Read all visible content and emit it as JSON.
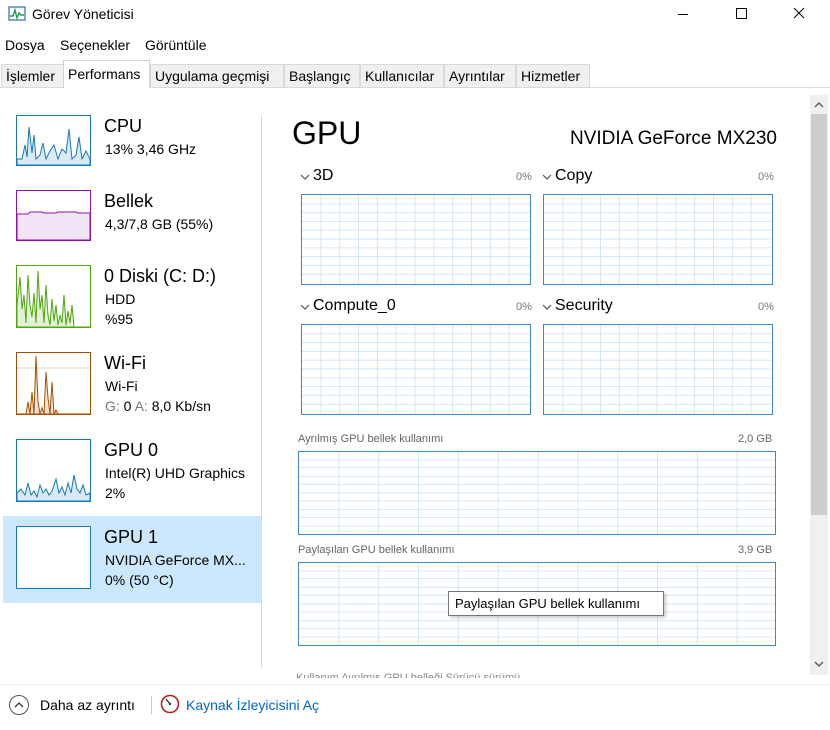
{
  "window": {
    "title": "Görev Yöneticisi",
    "icon": "task-manager-icon"
  },
  "menu": [
    "Dosya",
    "Seçenekler",
    "Görüntüle"
  ],
  "tabs": [
    {
      "label": "İşlemler",
      "active": false
    },
    {
      "label": "Performans",
      "active": true
    },
    {
      "label": "Uygulama geçmişi",
      "active": false
    },
    {
      "label": "Başlangıç",
      "active": false
    },
    {
      "label": "Kullanıcılar",
      "active": false
    },
    {
      "label": "Ayrıntılar",
      "active": false
    },
    {
      "label": "Hizmetler",
      "active": false
    }
  ],
  "sidebar": {
    "items": [
      {
        "title": "CPU",
        "line1": "13% 3,46 GHz",
        "line2": "",
        "color": "#1779ba"
      },
      {
        "title": "Bellek",
        "line1": "4,3/7,8 GB (55%)",
        "line2": "",
        "color": "#8b12ae"
      },
      {
        "title": "0 Diski (C: D:)",
        "line1": "HDD",
        "line2": "%95",
        "color": "#4da60c"
      },
      {
        "title": "Wi-Fi",
        "line1": "Wi-Fi",
        "line2_prefix_s": "G:",
        "line2_s": "0",
        "line2_prefix_r": "A:",
        "line2_r": "8,0 Kb/sn",
        "color": "#a74f01"
      },
      {
        "title": "GPU 0",
        "line1": "Intel(R) UHD Graphics",
        "line2": "2%",
        "color": "#1779ba"
      },
      {
        "title": "GPU 1",
        "line1": "NVIDIA GeForce MX...",
        "line2": "0% (50 °C)",
        "color": "#1779ba",
        "selected": true
      }
    ]
  },
  "main": {
    "heading": "GPU",
    "model": "NVIDIA GeForce MX230",
    "engines": [
      {
        "label": "3D",
        "pct": "0%"
      },
      {
        "label": "Copy",
        "pct": "0%"
      },
      {
        "label": "Compute_0",
        "pct": "0%"
      },
      {
        "label": "Security",
        "pct": "0%"
      }
    ],
    "dedicated": {
      "label": "Ayrılmış GPU bellek kullanımı",
      "max": "2,0 GB"
    },
    "shared": {
      "label": "Paylaşılan GPU bellek kullanımı",
      "max": "3,9 GB"
    },
    "tooltip": "Paylaşılan GPU bellek kullanımı",
    "cut_text": "Kullanım          Ayrılmış GPU belleği    Sürücü sürümü"
  },
  "footer": {
    "fewer_details": "Daha az ayrıntı",
    "resource_monitor": "Kaynak İzleyicisini Aç"
  },
  "colors": {
    "accent": "#1779ba",
    "selection": "#cce8ff",
    "link": "#0066cc",
    "graph_border": "#3e86c6"
  }
}
